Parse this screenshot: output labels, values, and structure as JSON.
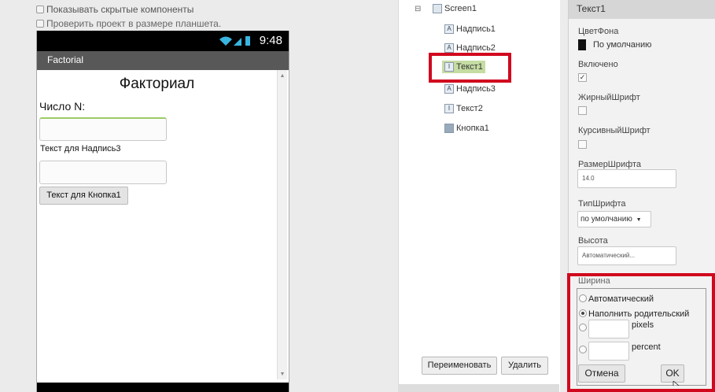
{
  "viewer": {
    "show_hidden_label": "Показывать скрытые компоненты",
    "tablet_preview_label": "Проверить проект в размере планшета."
  },
  "phone": {
    "time": "9:48",
    "app_title": "Factorial",
    "title_label": "Факториал",
    "number_label": "Число N:",
    "label3": "Текст для Надпись3",
    "button1": "Текст для Кнопка1"
  },
  "tree": {
    "collapse": "⊟",
    "items": [
      "Screen1",
      "Надпись1",
      "Надпись2",
      "Текст1",
      "Надпись3",
      "Текст2",
      "Кнопка1"
    ],
    "rename_label": "Переименовать",
    "delete_label": "Удалить"
  },
  "properties": {
    "title": "Текст1",
    "bg_color_label": "ЦветФона",
    "bg_color_value": "По умолчанию",
    "enabled_label": "Включено",
    "bold_label": "ЖирныйШрифт",
    "italic_label": "КурсивныйШрифт",
    "font_size_label": "РазмерШрифта",
    "font_size_value": "14.0",
    "font_type_label": "ТипШрифта",
    "font_type_value": "по умолчанию",
    "height_label": "Высота",
    "height_value": "Автоматический...",
    "width_label": "Ширина",
    "width_options": [
      "Автоматический",
      "Наполнить родительский"
    ],
    "pixels_label": "pixels",
    "percent_label": "percent",
    "cancel_label": "Отмена",
    "ok_label": "OK"
  },
  "colors": {
    "highlight": "#d1081e",
    "selected": "#c5dca2"
  }
}
